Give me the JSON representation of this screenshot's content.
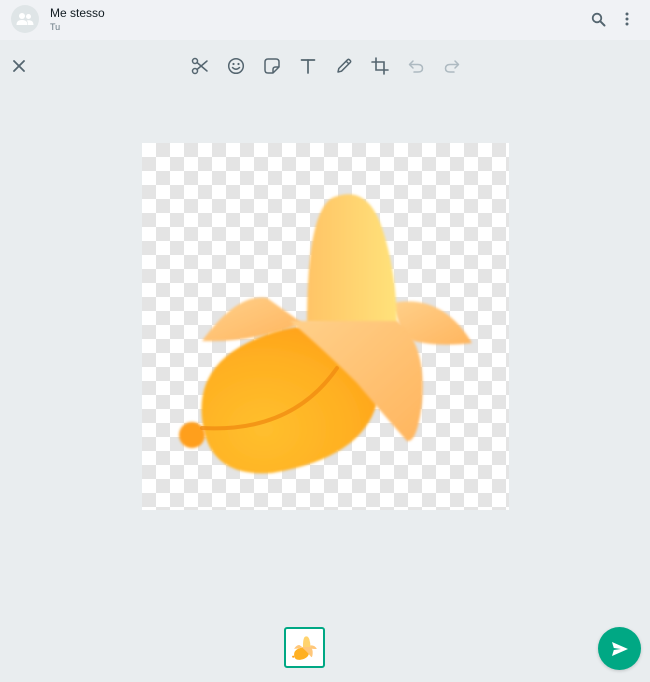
{
  "header": {
    "contact_name": "Me stesso",
    "contact_subtitle": "Tu",
    "icons": [
      "group-avatar-icon",
      "search-icon",
      "more-menu-icon"
    ]
  },
  "editor": {
    "tools": [
      "close-icon",
      "scissors-icon",
      "emoji-icon",
      "sticker-icon",
      "text-icon",
      "pencil-icon",
      "crop-rotate-icon",
      "undo-icon",
      "redo-icon"
    ],
    "image_subject": "banana-sticker",
    "thumbnail_selected": true
  },
  "colors": {
    "accent": "#00a884",
    "background": "#e9edef",
    "header_bg": "#f0f2f5",
    "icon": "#54656f",
    "icon_disabled": "#aebac1"
  }
}
